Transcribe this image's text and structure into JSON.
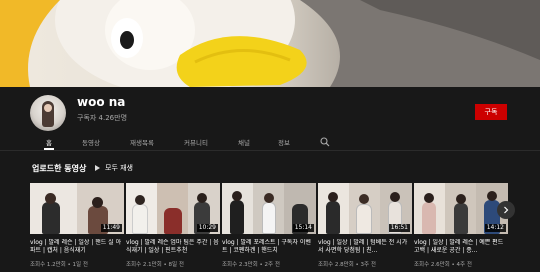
{
  "channel": {
    "name": "woo na",
    "subscribers": "구독자 4.26만명",
    "subscribe_label": "구독"
  },
  "tabs": [
    {
      "label": "홈",
      "active": true
    },
    {
      "label": "동영상",
      "active": false
    },
    {
      "label": "재생목록",
      "active": false
    },
    {
      "label": "커뮤니티",
      "active": false
    },
    {
      "label": "채널",
      "active": false
    },
    {
      "label": "정보",
      "active": false
    }
  ],
  "uploads": {
    "title": "업로드한 동영상",
    "play_all_label": "모두 재생"
  },
  "videos": [
    {
      "title": "vlog | 발레 레슨 | 일상 | 핸드 실 아파트 | 캡처 | 음식재기",
      "meta": "조회수 1.2만회 • 1일 전",
      "duration": "11:49"
    },
    {
      "title": "vlog | 발레 레슨 엄마 팀은 주간 | 음식재기 | 일상 | 핀트추천",
      "meta": "조회수 2.1만회 • 8일 전",
      "duration": "10:29"
    },
    {
      "title": "vlog | 발레 포레스트 | 구독자 이벤트 | 코펜하겐 | 핸드치",
      "meta": "조회수 2.3만회 • 2주 전",
      "duration": "15:14"
    },
    {
      "title": "vlog | 일상 | 발레 | 텀베든 전 시가서 사면학 당첨됨 | 친...",
      "meta": "조회수 2.8만회 • 3주 전",
      "duration": "16:51"
    },
    {
      "title": "vlog | 일상 | 발레 레슨 | 예쁜 편드 고백 | 새로운 공간 | 종...",
      "meta": "조회수 2.6만회 • 4주 전",
      "duration": "14:12"
    }
  ],
  "colors": {
    "background": "#181818",
    "subscribe": "#cc0000",
    "text_secondary": "#aaaaaa"
  },
  "icons": [
    "search-icon",
    "play-icon",
    "chevron-right-icon"
  ]
}
